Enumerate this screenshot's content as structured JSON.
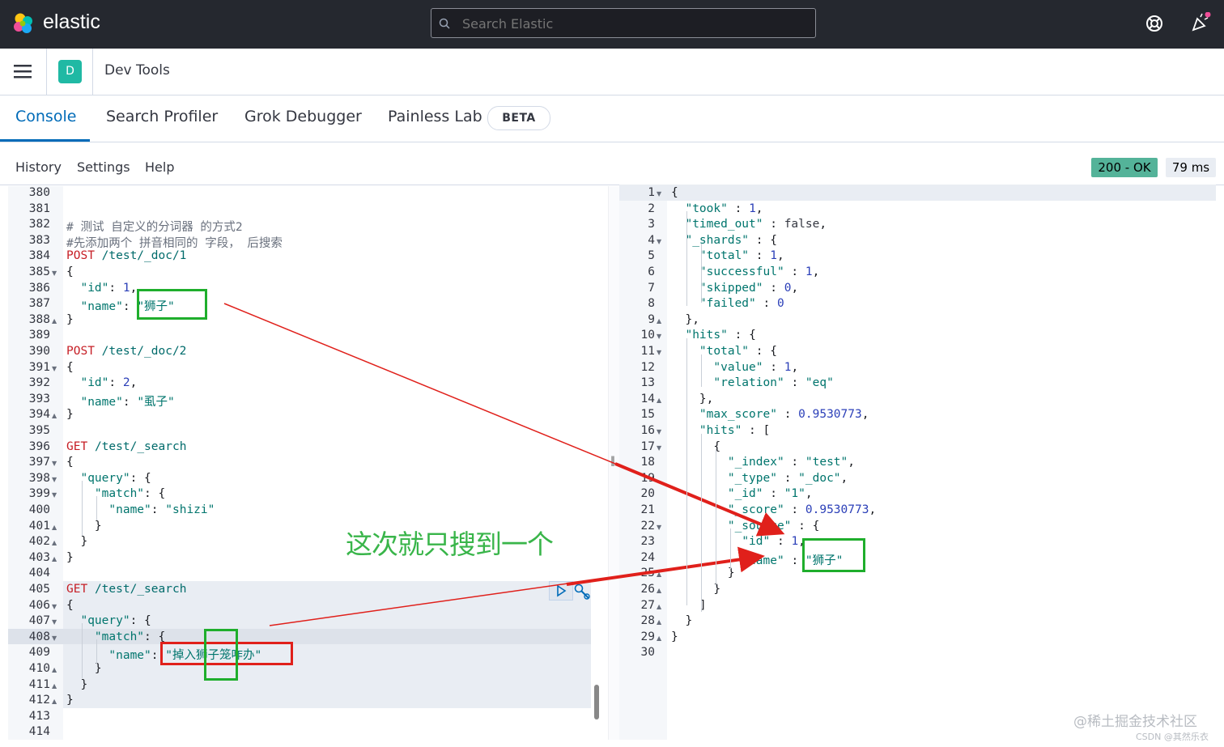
{
  "app": {
    "brand": "elastic",
    "breadcrumb": "Dev Tools",
    "space_initial": "D"
  },
  "search": {
    "placeholder": "Search Elastic"
  },
  "tabs": [
    {
      "label": "Console",
      "active": true
    },
    {
      "label": "Search Profiler"
    },
    {
      "label": "Grok Debugger"
    },
    {
      "label": "Painless Lab",
      "badge": "BETA"
    }
  ],
  "submenu": {
    "history": "History",
    "settings": "Settings",
    "help": "Help"
  },
  "response_status": {
    "status": "200 - OK",
    "time": "79 ms"
  },
  "colors": {
    "accent": "#006bb8",
    "status_ok": "#54b399",
    "annotation_green": "#39b54a",
    "annotation_red": "#e0201b"
  },
  "icons": [
    "elastic-logo-icon",
    "search-icon",
    "help-icon",
    "newsfeed-icon",
    "menu-icon",
    "play-icon",
    "wrench-icon"
  ],
  "left_editor": {
    "lines": [
      {
        "n": "380",
        "t": ""
      },
      {
        "n": "381",
        "t": ""
      },
      {
        "n": "382",
        "t": "# 测试 自定义的分词器 的方式2",
        "k": "comment"
      },
      {
        "n": "383",
        "t": "#先添加两个 拼音相同的 字段， 后搜索",
        "k": "comment"
      },
      {
        "n": "384",
        "t": "POST /test/_doc/1",
        "k": "req"
      },
      {
        "n": "385",
        "t": "{",
        "fold": "down"
      },
      {
        "n": "386",
        "t": "  \"id\": 1,"
      },
      {
        "n": "387",
        "t": "  \"name\": \"狮子\""
      },
      {
        "n": "388",
        "t": "}",
        "fold": "up"
      },
      {
        "n": "389",
        "t": ""
      },
      {
        "n": "390",
        "t": "POST /test/_doc/2",
        "k": "req"
      },
      {
        "n": "391",
        "t": "{",
        "fold": "down"
      },
      {
        "n": "392",
        "t": "  \"id\": 2,"
      },
      {
        "n": "393",
        "t": "  \"name\": \"虱子\""
      },
      {
        "n": "394",
        "t": "}",
        "fold": "up"
      },
      {
        "n": "395",
        "t": ""
      },
      {
        "n": "396",
        "t": "GET /test/_search",
        "k": "req"
      },
      {
        "n": "397",
        "t": "{",
        "fold": "down"
      },
      {
        "n": "398",
        "t": "  \"query\": {",
        "fold": "down"
      },
      {
        "n": "399",
        "t": "    \"match\": {",
        "fold": "down"
      },
      {
        "n": "400",
        "t": "      \"name\": \"shizi\""
      },
      {
        "n": "401",
        "t": "    }",
        "fold": "up"
      },
      {
        "n": "402",
        "t": "  }",
        "fold": "up"
      },
      {
        "n": "403",
        "t": "}",
        "fold": "up"
      },
      {
        "n": "404",
        "t": ""
      },
      {
        "n": "405",
        "t": "GET /test/_search",
        "k": "req"
      },
      {
        "n": "406",
        "t": "{",
        "fold": "down"
      },
      {
        "n": "407",
        "t": "  \"query\": {",
        "fold": "down"
      },
      {
        "n": "408",
        "t": "    \"match\": {",
        "fold": "down"
      },
      {
        "n": "409",
        "t": "      \"name\": \"掉入狮子笼咋办\""
      },
      {
        "n": "410",
        "t": "    }",
        "fold": "up"
      },
      {
        "n": "411",
        "t": "  }",
        "fold": "up"
      },
      {
        "n": "412",
        "t": "}",
        "fold": "up"
      },
      {
        "n": "413",
        "t": ""
      },
      {
        "n": "414",
        "t": ""
      }
    ]
  },
  "right_editor": {
    "lines": [
      {
        "n": "1",
        "t": "{",
        "fold": "down"
      },
      {
        "n": "2",
        "t": "  \"took\" : 1,"
      },
      {
        "n": "3",
        "t": "  \"timed_out\" : false,"
      },
      {
        "n": "4",
        "t": "  \"_shards\" : {",
        "fold": "down"
      },
      {
        "n": "5",
        "t": "    \"total\" : 1,"
      },
      {
        "n": "6",
        "t": "    \"successful\" : 1,"
      },
      {
        "n": "7",
        "t": "    \"skipped\" : 0,"
      },
      {
        "n": "8",
        "t": "    \"failed\" : 0"
      },
      {
        "n": "9",
        "t": "  },",
        "fold": "up"
      },
      {
        "n": "10",
        "t": "  \"hits\" : {",
        "fold": "down"
      },
      {
        "n": "11",
        "t": "    \"total\" : {",
        "fold": "down"
      },
      {
        "n": "12",
        "t": "      \"value\" : 1,"
      },
      {
        "n": "13",
        "t": "      \"relation\" : \"eq\""
      },
      {
        "n": "14",
        "t": "    },",
        "fold": "up"
      },
      {
        "n": "15",
        "t": "    \"max_score\" : 0.9530773,"
      },
      {
        "n": "16",
        "t": "    \"hits\" : [",
        "fold": "down"
      },
      {
        "n": "17",
        "t": "      {",
        "fold": "down"
      },
      {
        "n": "18",
        "t": "        \"_index\" : \"test\","
      },
      {
        "n": "19",
        "t": "        \"_type\" : \"_doc\","
      },
      {
        "n": "20",
        "t": "        \"_id\" : \"1\","
      },
      {
        "n": "21",
        "t": "        \"_score\" : 0.9530773,"
      },
      {
        "n": "22",
        "t": "        \"_source\" : {",
        "fold": "down"
      },
      {
        "n": "23",
        "t": "          \"id\" : 1,"
      },
      {
        "n": "24",
        "t": "          \"name\" : \"狮子\""
      },
      {
        "n": "25",
        "t": "        }",
        "fold": "up"
      },
      {
        "n": "26",
        "t": "      }",
        "fold": "up"
      },
      {
        "n": "27",
        "t": "    ]",
        "fold": "up"
      },
      {
        "n": "28",
        "t": "  }",
        "fold": "up"
      },
      {
        "n": "29",
        "t": "}",
        "fold": "up"
      },
      {
        "n": "30",
        "t": ""
      }
    ]
  },
  "annotation": {
    "text": "这次就只搜到一个"
  },
  "watermark": {
    "line1": "@稀土掘金技术社区",
    "line2": "CSDN @其然乐衣"
  }
}
